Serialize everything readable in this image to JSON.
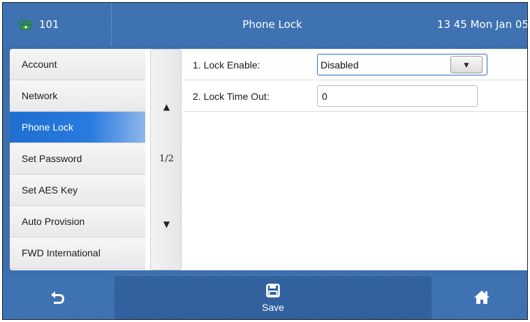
{
  "header": {
    "extension": "101",
    "title": "Phone Lock",
    "datetime": "13 45 Mon Jan 05"
  },
  "sidebar": {
    "items": [
      {
        "label": "Account",
        "active": false
      },
      {
        "label": "Network",
        "active": false
      },
      {
        "label": "Phone Lock",
        "active": true
      },
      {
        "label": "Set Password",
        "active": false
      },
      {
        "label": "Set AES Key",
        "active": false
      },
      {
        "label": "Auto Provision",
        "active": false
      },
      {
        "label": "FWD International",
        "active": false
      }
    ]
  },
  "pager": {
    "page": "1/2",
    "up_icon": "triangle-up-icon",
    "down_icon": "triangle-down-icon"
  },
  "settings": {
    "lock_enable": {
      "label": "1. Lock Enable:",
      "value": "Disabled"
    },
    "lock_timeout": {
      "label": "2. Lock Time Out:",
      "value": "0"
    }
  },
  "softkeys": {
    "back_icon": "back-arrow-icon",
    "save_label": "Save",
    "save_icon": "floppy-disk-icon",
    "home_icon": "home-icon"
  },
  "colors": {
    "bar_blue": "#3c70b1",
    "selected_blue": "#1f6fd0",
    "phone_icon_green": "#2ea043"
  }
}
